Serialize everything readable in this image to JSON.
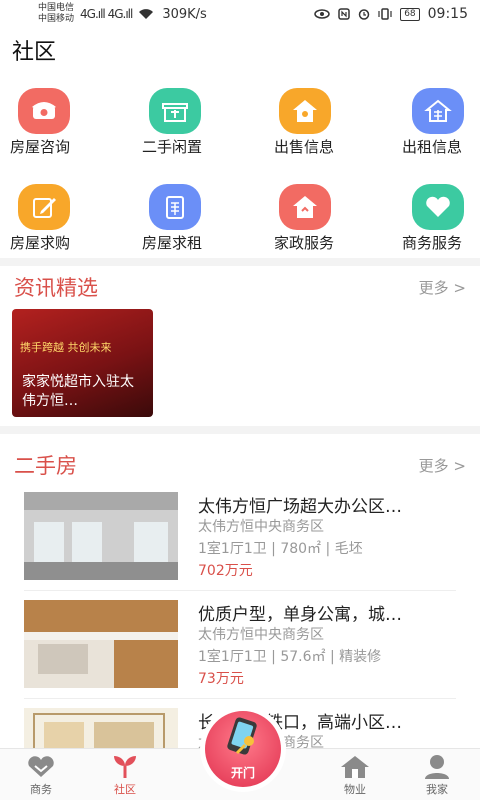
{
  "status_bar": {
    "carrier1": "中国电信",
    "carrier2": "中国移动",
    "signal1": "4G.ıll",
    "signal2": "4G.ıll",
    "speed": "309K/s",
    "battery": "68",
    "time": "09:15"
  },
  "page_title": "社区",
  "grid": [
    {
      "label": "房屋咨询",
      "icon": "phone-icon",
      "color": "#f26b63"
    },
    {
      "label": "二手闲置",
      "icon": "gift-icon",
      "color": "#3ccaa1"
    },
    {
      "label": "出售信息",
      "icon": "house-sale-icon",
      "color": "#f8a72a"
    },
    {
      "label": "出租信息",
      "icon": "house-rent-icon",
      "color": "#6b8ff7"
    },
    {
      "label": "房屋求购",
      "icon": "edit-icon",
      "color": "#f8a72a"
    },
    {
      "label": "房屋求租",
      "icon": "rent-doc-icon",
      "color": "#6b8ff7"
    },
    {
      "label": "家政服务",
      "icon": "home-service-icon",
      "color": "#f26b63"
    },
    {
      "label": "商务服务",
      "icon": "heart-icon",
      "color": "#3ccaa1"
    }
  ],
  "news": {
    "title": "资讯精选",
    "more": "更多 >",
    "items": [
      {
        "banner": "携手跨越  共创未来",
        "title": "家家悦超市入驻太伟方恒…"
      }
    ]
  },
  "second_hand": {
    "title": "二手房",
    "more": "更多 >",
    "listings": [
      {
        "title": "太伟方恒广场超大办公区…",
        "area": "太伟方恒中央商务区",
        "spec": "1室1厅1卫 | 780㎡ | 毛坯",
        "price": "702万元"
      },
      {
        "title": "优质户型，单身公寓，城…",
        "area": "太伟方恒中央商务区",
        "spec": "1室1厅1卫 | 57.6㎡ | 精装修",
        "price": "73万元"
      },
      {
        "title": "长乐宫地铁口，高端小区…",
        "area": "太伟方恒中央商务区",
        "spec": "",
        "price": ""
      }
    ]
  },
  "bottom_nav": {
    "business": "商务",
    "community": "社区",
    "open": "开门",
    "property": "物业",
    "me": "我家"
  },
  "colors": {
    "accent": "#d9504a"
  }
}
